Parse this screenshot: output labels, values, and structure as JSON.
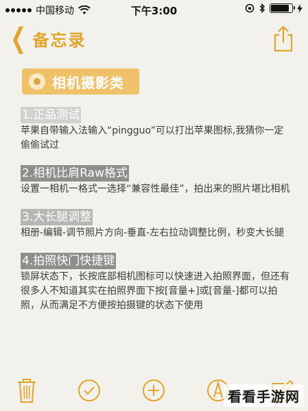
{
  "status_bar": {
    "carrier": "中国移动",
    "time": "下午3:00",
    "battery_level": 0.85
  },
  "nav": {
    "back_label": "备忘录",
    "accent_color": "#e2a52b"
  },
  "note": {
    "category": "相机摄影类",
    "sections": [
      {
        "heading": "1.正品测试",
        "body": "苹果自带输入法输入“pingguo”可以打出苹果图标,我猜你一定偷偷试过"
      },
      {
        "heading": "2.相机比肩Raw格式",
        "body": "设置一相机一格式一选择“兼容性最佳”，拍出来的照片堪比相机"
      },
      {
        "heading": "3.大长腿调整",
        "body": "相册-编辑-调节照片方向-垂直-左右拉动调整比例，秒变大长腿"
      },
      {
        "heading": "4.拍照快门快捷键",
        "body": "锁屏状态下，长按底部相机图标可以快速进入拍照界面，但还有很多人不知道其实在拍照界面下按[音量+]或[音量-]都可以拍照，从而满足不方便按拍摄键的状态下使用"
      }
    ]
  },
  "toolbar": {
    "icons": [
      "trash-icon",
      "checkmark-icon",
      "add-icon",
      "sketch-icon",
      "compose-icon"
    ]
  },
  "watermark": "看看手游网"
}
